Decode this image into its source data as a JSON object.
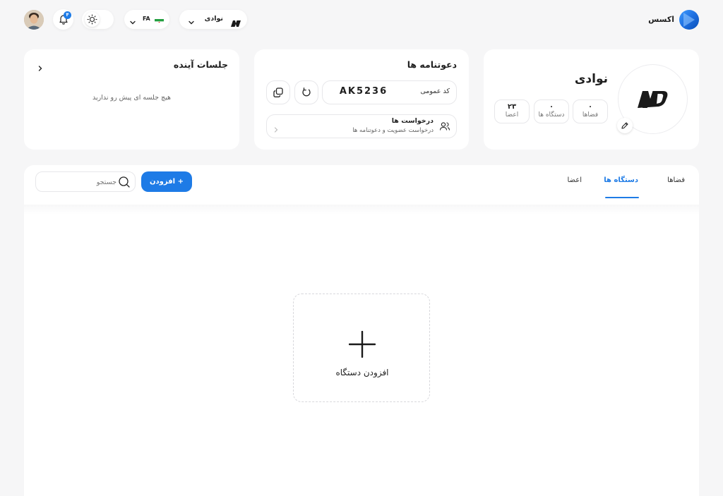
{
  "brand": {
    "name": "اکسس",
    "color": "#1e7be6"
  },
  "topbar": {
    "workspace_label": "نوادی",
    "language_code": "FA",
    "notification_count": "۴",
    "accent": "#1e7be6"
  },
  "profile": {
    "name": "نوادی",
    "stats": [
      {
        "value": "۰",
        "label": "فضاها"
      },
      {
        "value": "۰",
        "label": "دستگاه ها"
      },
      {
        "value": "۲۳",
        "label": "اعضا"
      }
    ]
  },
  "invites": {
    "title": "دعوتنامه ها",
    "code_label": "کد عمومی",
    "code_value": "AK5236",
    "requests_title": "درخواست ها",
    "requests_subtitle": "درخواست عضویت و دعوتنامه ها"
  },
  "sessions": {
    "title": "جلسات آینده",
    "empty_text": "هیچ جلسه ای پیش رو ندارید"
  },
  "tabs": [
    {
      "label": "فضاها",
      "active": false
    },
    {
      "label": "دستگاه ها",
      "active": true
    },
    {
      "label": "اعضا",
      "active": false
    }
  ],
  "toolbar": {
    "add_label": "افزودن +",
    "search_placeholder": "جستجو"
  },
  "empty_state": {
    "add_device_label": "افزودن دستگاه"
  }
}
